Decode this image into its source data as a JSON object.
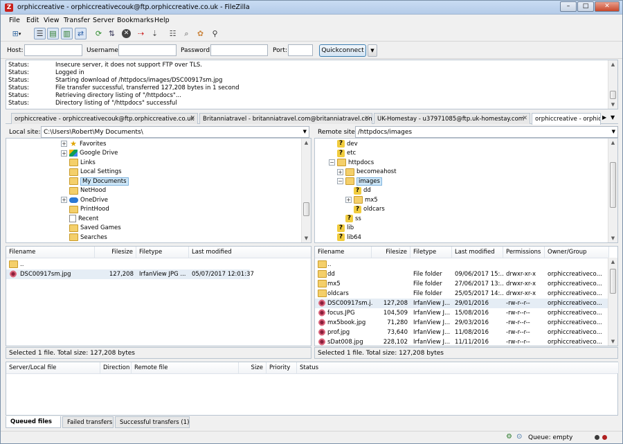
{
  "window": {
    "title": "orphiccreative - orphiccreativecouk@ftp.orphiccreative.co.uk - FileZilla"
  },
  "menu": [
    "File",
    "Edit",
    "View",
    "Transfer",
    "Server",
    "Bookmarks",
    "Help"
  ],
  "quickconnect": {
    "host_label": "Host:",
    "host_value": "",
    "username_label": "Username:",
    "username_value": "",
    "password_label": "Password:",
    "password_value": "",
    "port_label": "Port:",
    "port_value": "",
    "button": "Quickconnect"
  },
  "log": [
    {
      "k": "Status:",
      "v": "Insecure server, it does not support FTP over TLS."
    },
    {
      "k": "Status:",
      "v": "Logged in"
    },
    {
      "k": "Status:",
      "v": "Starting download of /httpdocs/images/DSC00917sm.jpg"
    },
    {
      "k": "Status:",
      "v": "File transfer successful, transferred 127,208 bytes in 1 second"
    },
    {
      "k": "Status:",
      "v": "Retrieving directory listing of \"/httpdocs\"..."
    },
    {
      "k": "Status:",
      "v": "Directory listing of \"/httpdocs\" successful"
    }
  ],
  "tabs": [
    "orphiccreative - orphiccreativecouk@ftp.orphiccreative.co.uk",
    "Britanniatravel - britanniatravel.com@britanniatravel.com",
    "UK-Homestay - u37971085@ftp.uk-homestay.com",
    "orphiccreative - orphicc"
  ],
  "local": {
    "site_label": "Local site:",
    "path": "C:\\Users\\Robert\\My Documents\\",
    "tree": [
      {
        "label": "Favorites",
        "icon": "star"
      },
      {
        "label": "Google Drive",
        "icon": "gdrive"
      },
      {
        "label": "Links",
        "icon": "folder"
      },
      {
        "label": "Local Settings",
        "icon": "folder"
      },
      {
        "label": "My Documents",
        "icon": "folder",
        "selected": true
      },
      {
        "label": "NetHood",
        "icon": "folder"
      },
      {
        "label": "OneDrive",
        "icon": "cloud"
      },
      {
        "label": "PrintHood",
        "icon": "folder"
      },
      {
        "label": "Recent",
        "icon": "doc"
      },
      {
        "label": "Saved Games",
        "icon": "folder"
      },
      {
        "label": "Searches",
        "icon": "folder"
      }
    ],
    "columns": [
      "Filename",
      "Filesize",
      "Filetype",
      "Last modified"
    ],
    "files": [
      {
        "name": "..",
        "size": "",
        "type": "",
        "modified": ""
      },
      {
        "name": "DSC00917sm.jpg",
        "size": "127,208",
        "type": "IrfanView JPG ...",
        "modified": "05/07/2017 12:01:37"
      }
    ],
    "status": "Selected 1 file. Total size: 127,208 bytes"
  },
  "remote": {
    "site_label": "Remote site:",
    "path": "/httpdocs/images",
    "tree": [
      {
        "label": "dev",
        "icon": "qmark",
        "depth": 1
      },
      {
        "label": "etc",
        "icon": "qmark",
        "depth": 1
      },
      {
        "label": "httpdocs",
        "icon": "folder",
        "depth": 1
      },
      {
        "label": "becomeahost",
        "icon": "folder",
        "depth": 2
      },
      {
        "label": "images",
        "icon": "folder",
        "depth": 2,
        "selected": true
      },
      {
        "label": "dd",
        "icon": "qmark",
        "depth": 3
      },
      {
        "label": "mx5",
        "icon": "folder",
        "depth": 3
      },
      {
        "label": "oldcars",
        "icon": "qmark",
        "depth": 3
      },
      {
        "label": "ss",
        "icon": "qmark",
        "depth": 2
      },
      {
        "label": "lib",
        "icon": "qmark",
        "depth": 1
      },
      {
        "label": "lib64",
        "icon": "qmark",
        "depth": 1
      }
    ],
    "columns": [
      "Filename",
      "Filesize",
      "Filetype",
      "Last modified",
      "Permissions",
      "Owner/Group"
    ],
    "files": [
      {
        "name": "..",
        "size": "",
        "type": "",
        "modified": "",
        "perm": "",
        "owner": "",
        "icon": "folder"
      },
      {
        "name": "dd",
        "size": "",
        "type": "File folder",
        "modified": "09/06/2017 15:...",
        "perm": "drwxr-xr-x",
        "owner": "orphiccreativeco...",
        "icon": "folder"
      },
      {
        "name": "mx5",
        "size": "",
        "type": "File folder",
        "modified": "27/06/2017 13:...",
        "perm": "drwxr-xr-x",
        "owner": "orphiccreativeco...",
        "icon": "folder"
      },
      {
        "name": "oldcars",
        "size": "",
        "type": "File folder",
        "modified": "25/05/2017 14:...",
        "perm": "drwxr-xr-x",
        "owner": "orphiccreativeco...",
        "icon": "folder"
      },
      {
        "name": "DSC00917sm.j...",
        "size": "127,208",
        "type": "IrfanView J...",
        "modified": "29/01/2016",
        "perm": "-rw-r--r--",
        "owner": "orphiccreativeco...",
        "icon": "jpg",
        "selected": true
      },
      {
        "name": "focus.JPG",
        "size": "104,509",
        "type": "IrfanView J...",
        "modified": "15/08/2016",
        "perm": "-rw-r--r--",
        "owner": "orphiccreativeco...",
        "icon": "jpg"
      },
      {
        "name": "mx5book.jpg",
        "size": "71,280",
        "type": "IrfanView J...",
        "modified": "29/03/2016",
        "perm": "-rw-r--r--",
        "owner": "orphiccreativeco...",
        "icon": "jpg"
      },
      {
        "name": "prof.jpg",
        "size": "73,640",
        "type": "IrfanView J...",
        "modified": "11/08/2016",
        "perm": "-rw-r--r--",
        "owner": "orphiccreativeco...",
        "icon": "jpg"
      },
      {
        "name": "sDat008.jpg",
        "size": "228,102",
        "type": "IrfanView J...",
        "modified": "11/11/2016",
        "perm": "-rw-r--r--",
        "owner": "orphiccreativeco...",
        "icon": "jpg"
      }
    ],
    "status": "Selected 1 file. Total size: 127,208 bytes"
  },
  "queue": {
    "columns": [
      "Server/Local file",
      "Direction",
      "Remote file",
      "Size",
      "Priority",
      "Status"
    ],
    "tabs": [
      "Queued files",
      "Failed transfers",
      "Successful transfers (1)"
    ],
    "status": "Queue: empty"
  },
  "colors": {
    "accent": "#3c7fb1",
    "selection": "#cde6f7",
    "close": "#c9472a"
  }
}
